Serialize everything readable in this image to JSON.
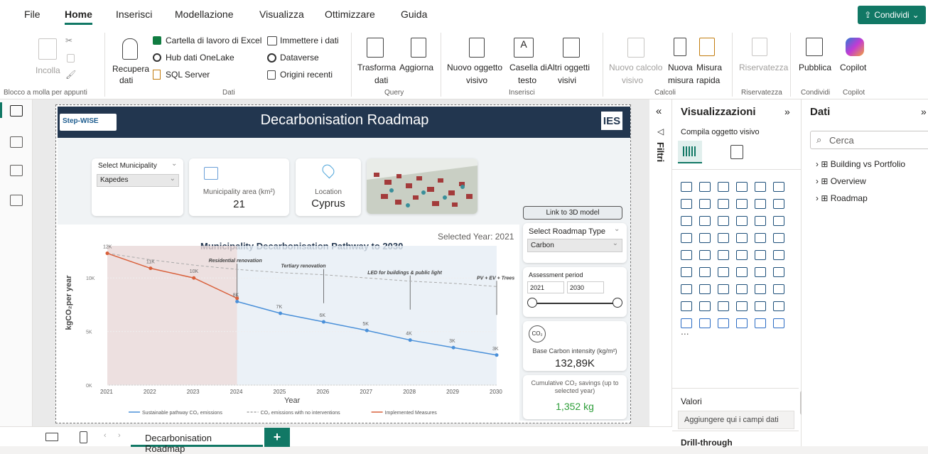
{
  "menu": {
    "file": "File",
    "home": "Home",
    "insert": "Inserisci",
    "modeling": "Modellazione",
    "view": "Visualizza",
    "optimize": "Ottimizzare",
    "help": "Guida",
    "share": "Condividi"
  },
  "ribbon": {
    "paste": "Incolla",
    "clipboard_group": "Blocco a molla per appunti",
    "get_data_1": "Recupera",
    "get_data_2": "dati",
    "excel": "Cartella di lavoro di Excel",
    "onelake": "Hub dati OneLake",
    "sql": "SQL Server",
    "enter_data": "Immettere i dati",
    "dataverse": "Dataverse",
    "recent": "Origini recenti",
    "data_group": "Dati",
    "transform_1": "Trasforma",
    "transform_2": "dati",
    "refresh": "Aggiorna",
    "query_group": "Query",
    "new_visual_1": "Nuovo oggetto",
    "new_visual_2": "visivo",
    "textbox_1": "Casella di",
    "textbox_2": "testo",
    "more_visuals_1": "Altri oggetti",
    "more_visuals_2": "visivi",
    "insert_group": "Inserisci",
    "new_calc_1": "Nuovo calcolo",
    "new_calc_2": "visivo",
    "new_measure_1": "Nuova",
    "new_measure_2": "misura",
    "quick_measure_1": "Misura",
    "quick_measure_2": "rapida",
    "calc_group": "Calcoli",
    "sensitivity": "Riservatezza",
    "sensitivity_group": "Riservatezza",
    "publish": "Pubblica",
    "share_group": "Condividi",
    "copilot": "Copilot",
    "copilot_group": "Copilot"
  },
  "report": {
    "title": "Decarbonisation Roadmap",
    "logo_text": "Step-WISE",
    "ies": "IES",
    "municipality_label": "Select Municipality",
    "municipality_value": "Kapedes",
    "area_label": "Municipality area (km²)",
    "area_value": "21",
    "location_label": "Location",
    "location_value": "Cyprus",
    "link_3d": "Link to 3D model",
    "selected_year": "Selected Year: 2021",
    "roadmap_type_label": "Select Roadmap Type",
    "roadmap_type_value": "Carbon",
    "assessment_label": "Assessment period",
    "period_start": "2021",
    "period_end": "2030",
    "base_intensity_label": "Base Carbon intensity (kg/m²)",
    "base_intensity_value": "132,89K",
    "cumulative_label": "Cumulative CO₂ savings (up to selected year)",
    "cumulative_value": "1,352 kg"
  },
  "chart_data": {
    "type": "line",
    "title": "Municipality Decarbonisation Pathway to 2030",
    "xlabel": "Year",
    "ylabel": "kgCO₂per year",
    "x": [
      2021,
      2022,
      2023,
      2024,
      2025,
      2026,
      2027,
      2028,
      2029,
      2030
    ],
    "yticks": [
      "0K",
      "5K",
      "10K"
    ],
    "ylim": [
      0,
      13000
    ],
    "series": [
      {
        "name": "Sustainable pathway CO₂ emissions",
        "color": "#4a90d9",
        "x": [
          2024,
          2025,
          2026,
          2027,
          2028,
          2029,
          2030
        ],
        "values": [
          7800,
          6700,
          5900,
          5100,
          4200,
          3500,
          2800
        ]
      },
      {
        "name": "CO₂ emissions with no interventions",
        "color": "#aaaaaa",
        "dash": true,
        "x": [
          2021,
          2022,
          2023,
          2024,
          2025,
          2026,
          2027,
          2028,
          2029,
          2030
        ],
        "values": [
          12300,
          11700,
          11200,
          10800,
          10500,
          10300,
          10000,
          9700,
          9500,
          9200
        ]
      },
      {
        "name": "Implemented Measures",
        "color": "#d9603b",
        "x": [
          2021,
          2022,
          2023,
          2024
        ],
        "values": [
          12300,
          10900,
          10000,
          8100
        ]
      }
    ],
    "data_labels": [
      {
        "x": 2021,
        "text": "12K"
      },
      {
        "x": 2022,
        "text": "11K"
      },
      {
        "x": 2023,
        "text": "10K"
      },
      {
        "x": 2024,
        "text": "8K"
      },
      {
        "x": 2025,
        "text": "7K"
      },
      {
        "x": 2026,
        "text": "6K"
      },
      {
        "x": 2027,
        "text": "5K"
      },
      {
        "x": 2028,
        "text": "4K"
      },
      {
        "x": 2029,
        "text": "3K"
      },
      {
        "x": 2030,
        "text": "3K"
      }
    ],
    "annotations": [
      {
        "x": 2024,
        "text": "Residential renovation"
      },
      {
        "x": 2026,
        "text": "Tertiary renovation"
      },
      {
        "x": 2028,
        "text": "LED for buildings & public light"
      },
      {
        "x": 2030,
        "text": "PV + EV + Trees"
      }
    ]
  },
  "filters": {
    "label": "Filtri"
  },
  "viz_pane": {
    "title": "Visualizzazioni",
    "subtitle": "Compila oggetto visivo",
    "values_label": "Valori",
    "values_placeholder": "Aggiungere qui i campi dati",
    "drillthrough": "Drill-through",
    "more": "..."
  },
  "data_pane": {
    "title": "Dati",
    "search_placeholder": "Cerca",
    "tables": [
      "Building vs Portfolio",
      "Overview",
      "Roadmap"
    ]
  },
  "bottom": {
    "page_tab": "Decarbonisation Roadmap",
    "add": "+"
  }
}
